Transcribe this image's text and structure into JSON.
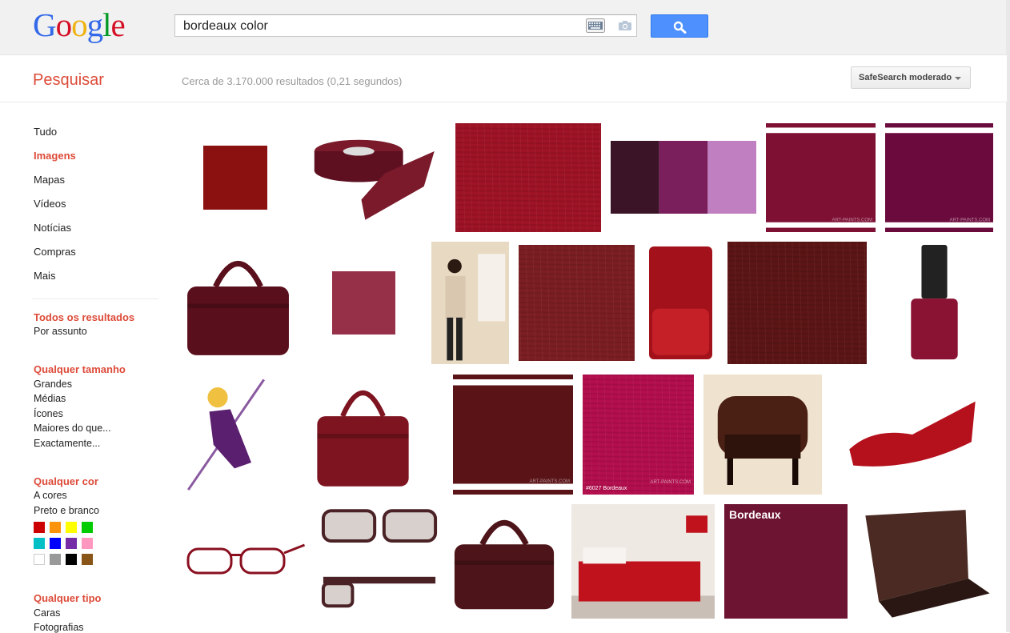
{
  "header": {
    "logo_letters": [
      {
        "ch": "G",
        "color": "#3369e8"
      },
      {
        "ch": "o",
        "color": "#d50f25"
      },
      {
        "ch": "o",
        "color": "#eeb211"
      },
      {
        "ch": "g",
        "color": "#3369e8"
      },
      {
        "ch": "l",
        "color": "#009925"
      },
      {
        "ch": "e",
        "color": "#d50f25"
      }
    ],
    "search_query": "bordeaux color",
    "keyboard_icon": "keyboard-icon",
    "camera_icon": "camera-icon",
    "search_icon": "magnifier-icon",
    "button_color": "#4d90fe"
  },
  "subbar": {
    "section_title": "Pesquisar",
    "results_stats": "Cerca de 3.170.000 resultados (0,21 segundos)",
    "safesearch_label": "SafeSearch moderado"
  },
  "nav": {
    "items": [
      {
        "label": "Tudo",
        "active": false
      },
      {
        "label": "Imagens",
        "active": true
      },
      {
        "label": "Mapas",
        "active": false
      },
      {
        "label": "Vídeos",
        "active": false
      },
      {
        "label": "Notícias",
        "active": false
      },
      {
        "label": "Compras",
        "active": false
      },
      {
        "label": "Mais",
        "active": false
      }
    ]
  },
  "filters": {
    "results": {
      "head": "Todos os resultados",
      "items": [
        "Por assunto"
      ]
    },
    "size": {
      "head": "Qualquer tamanho",
      "items": [
        "Grandes",
        "Médias",
        "Ícones",
        "Maiores do que...",
        "Exactamente..."
      ]
    },
    "color": {
      "head": "Qualquer cor",
      "items": [
        "A cores",
        "Preto e branco"
      ],
      "swatches": [
        "#cc0000",
        "#fb940b",
        "#ffff00",
        "#00cc00",
        "#03c0c6",
        "#0000ff",
        "#762ca7",
        "#ff98bf",
        "#ffffff",
        "#999999",
        "#000000",
        "#885418"
      ]
    },
    "type": {
      "head": "Qualquer tipo",
      "items": [
        "Caras",
        "Fotografias"
      ]
    }
  },
  "images": {
    "accent_color": "#76172d",
    "tile_labels": {
      "bordeaux_card": "Bordeaux",
      "swatch_code": "#6027 Bordeaux",
      "watermark": "ART-PAINTS.COM"
    },
    "tiles": [
      {
        "name": "burgundy-fabric-swatch-thumbnail",
        "kind": "square",
        "color": "#8b1010"
      },
      {
        "name": "satin-ribbon-roll-thumbnail",
        "kind": "ribbon",
        "color": "#7a1a2b"
      },
      {
        "name": "red-linen-texture-thumbnail",
        "kind": "texture",
        "color": "#9e1325"
      },
      {
        "name": "paint-strokes-thumbnail",
        "kind": "strokes",
        "color": "#5c1a3c"
      },
      {
        "name": "art-paints-swatch-thumbnail",
        "kind": "striped",
        "color": "#7e1034"
      },
      {
        "name": "purple-swatch-thumbnail",
        "kind": "striped",
        "color": "#6b0a3d"
      },
      {
        "name": "leather-handbag-thumbnail",
        "kind": "bag",
        "color": "#5a0f1c"
      },
      {
        "name": "bordeaux-square-thumbnail",
        "kind": "square",
        "color": "#963048"
      },
      {
        "name": "fashion-photo-thumbnail",
        "kind": "photo",
        "color": "#6e3b2a"
      },
      {
        "name": "leather-texture-thumbnail",
        "kind": "texture",
        "color": "#7b1e22"
      },
      {
        "name": "leather-case-thumbnail",
        "kind": "case",
        "color": "#a3121a"
      },
      {
        "name": "dark-leather-thumbnail",
        "kind": "texture",
        "color": "#5c1515"
      },
      {
        "name": "nail-polish-thumbnail",
        "kind": "polish",
        "color": "#8a1233"
      },
      {
        "name": "cartoon-hero-thumbnail",
        "kind": "hero",
        "color": "#5b1f70"
      },
      {
        "name": "patent-tote-bag-thumbnail",
        "kind": "bag",
        "color": "#7d1420"
      },
      {
        "name": "maroon-swatch-thumbnail",
        "kind": "striped",
        "color": "#5a1418"
      },
      {
        "name": "pink-paint-swatch-thumbnail",
        "kind": "texture",
        "color": "#b30e4e"
      },
      {
        "name": "leather-armchair-thumbnail",
        "kind": "chair",
        "color": "#4a1f14"
      },
      {
        "name": "red-flat-shoe-thumbnail",
        "kind": "shoe",
        "color": "#b5111c"
      },
      {
        "name": "red-glasses-thumbnail",
        "kind": "glasses",
        "color": "#8a1020"
      },
      {
        "name": "sunglasses-thumbnail",
        "kind": "sunglasses",
        "color": "#4a2226"
      },
      {
        "name": "slouch-handbag-thumbnail",
        "kind": "bag",
        "color": "#4d1419"
      },
      {
        "name": "red-bedroom-thumbnail",
        "kind": "bedroom",
        "color": "#c0121c"
      },
      {
        "name": "bordeaux-card-thumbnail",
        "kind": "card",
        "color": "#6e1433"
      },
      {
        "name": "laptop-thumbnail",
        "kind": "laptop",
        "color": "#4a2a22"
      }
    ]
  }
}
